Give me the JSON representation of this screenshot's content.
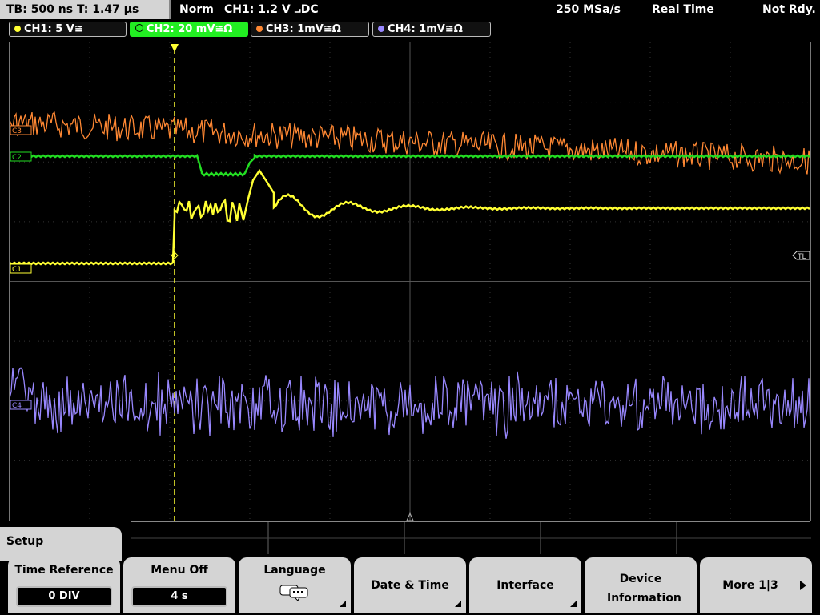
{
  "status_bar": {
    "timebase": "TB: 500 ns   T: 1.47 µs",
    "trigger_mode": "Norm",
    "trigger_info": "CH1: 1.2 V ⨼DC",
    "sample_rate": "250 MSa/s",
    "acquisition_mode": "Real Time",
    "state": "Not Rdy."
  },
  "channels": [
    {
      "label": "CH1: 5 V≅",
      "color": "#ffff33"
    },
    {
      "label": "CH2: 20 mV≅Ω",
      "color": "#22dd22"
    },
    {
      "label": "CH3: 1mV≅Ω",
      "color": "#ff8833"
    },
    {
      "label": "CH4: 1mV≅Ω",
      "color": "#9988ff"
    }
  ],
  "markers": {
    "trigger_pos": "T",
    "trigger_level": "TL",
    "ch1": "C1",
    "ch2": "C2",
    "ch3": "C3",
    "ch4": "C4"
  },
  "menu": {
    "title": "Setup",
    "keys": [
      {
        "label": "Time Reference",
        "value": "0 DIV"
      },
      {
        "label": "Menu Off",
        "value": "4 s"
      },
      {
        "label": "Language",
        "icon": "speech-bubble-icon"
      },
      {
        "label": "Date & Time"
      },
      {
        "label": "Interface"
      },
      {
        "label": "Device Information"
      },
      {
        "label": "More 1|3"
      }
    ]
  }
}
